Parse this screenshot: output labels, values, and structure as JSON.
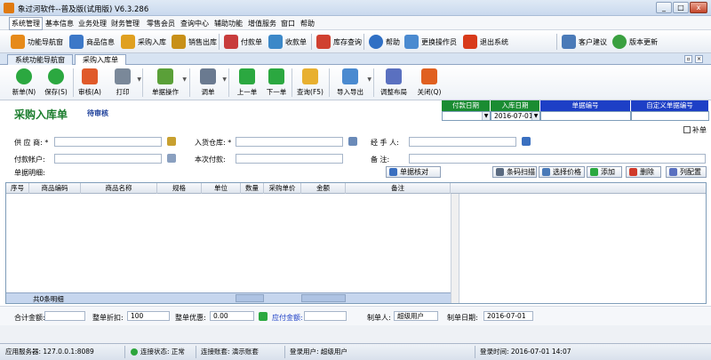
{
  "window": {
    "title": "象过河软件--普及版(试用版) V6.3.286",
    "min": "_",
    "max": "□",
    "close": "x"
  },
  "menu": [
    "系统管理",
    "基本信息",
    "业务处理",
    "财务管理",
    "零售会员",
    "查询中心",
    "辅助功能",
    "增值服务",
    "窗口",
    "帮助"
  ],
  "quickbar": [
    {
      "label": "功能导航窗",
      "icon": "home-icon",
      "color": "#e68a1a"
    },
    {
      "label": "商品信息",
      "icon": "product-grid-icon",
      "color": "#3c78c8"
    },
    {
      "label": "采购入库",
      "icon": "purchase-in-icon",
      "color": "#e0a020"
    },
    {
      "label": "销售出库",
      "icon": "sales-out-icon",
      "color": "#c89018"
    },
    {
      "label": "付款单",
      "icon": "payment-icon",
      "color": "#c83c3c"
    },
    {
      "label": "收款单",
      "icon": "receipt-icon",
      "color": "#3c88c8"
    },
    {
      "label": "库存查询",
      "icon": "stock-query-icon",
      "color": "#d04030"
    },
    {
      "label": "帮助",
      "icon": "help-icon",
      "color": "#2f6fc4"
    },
    {
      "label": "更换操作员",
      "icon": "change-operator-icon",
      "color": "#4a8ad0"
    },
    {
      "label": "退出系统",
      "icon": "exit-icon",
      "color": "#d83a1a"
    },
    {
      "label": "客户建议",
      "icon": "suggestion-icon",
      "color": "#4a7ab8"
    },
    {
      "label": "版本更新",
      "icon": "update-icon",
      "color": "#3aa040"
    }
  ],
  "tabs": [
    "系统功能导航窗",
    "采购入库单"
  ],
  "toolbar": [
    {
      "label": "新单(N)",
      "icon": "new-plus-icon",
      "color": "#2ba840"
    },
    {
      "label": "保存(S)",
      "icon": "save-check-icon",
      "color": "#2ba840"
    },
    {
      "label": "审核(A)",
      "icon": "audit-icon",
      "color": "#e05a2a"
    },
    {
      "label": "打印",
      "icon": "print-icon",
      "color": "#7a8899"
    },
    {
      "label": "单据操作",
      "icon": "document-icon",
      "color": "#5aa038"
    },
    {
      "label": "调单",
      "icon": "call-bill-icon",
      "color": "#6a7a90"
    },
    {
      "label": "上一单",
      "icon": "prev-icon",
      "color": "#2ba840"
    },
    {
      "label": "下一单",
      "icon": "next-icon",
      "color": "#2ba840"
    },
    {
      "label": "查询(F5)",
      "icon": "query-icon",
      "color": "#e8b030"
    },
    {
      "label": "导入导出",
      "icon": "import-export-icon",
      "color": "#4a8ad0"
    },
    {
      "label": "调整布局",
      "icon": "layout-icon",
      "color": "#5a70c0"
    },
    {
      "label": "关闭(Q)",
      "icon": "close-x-icon",
      "color": "#e06020"
    }
  ],
  "form": {
    "title": "采购入库单",
    "status": "待审核",
    "header_cols": [
      {
        "label": "付款日期",
        "value": ""
      },
      {
        "label": "入库日期",
        "value": "2016-07-01"
      },
      {
        "label": "单据编号",
        "value": ""
      },
      {
        "label": "自定义单据编号",
        "value": ""
      }
    ],
    "supplement": "补单",
    "fields": {
      "supplier": "供 应 商: *",
      "warehouse": "入货仓库: *",
      "handler": "经 手 人:",
      "pay_account": "付款帐户:",
      "this_payment": "本次付款:",
      "note": "备    注:"
    },
    "detail_label": "单据明细:",
    "actions": {
      "check": "单据核对",
      "scan": "条码扫描",
      "price": "选择价格",
      "add": "添加",
      "delete": "删除",
      "columns": "列配置"
    },
    "columns": [
      "序号",
      "商品编码",
      "商品名称",
      "规格",
      "单位",
      "数量",
      "采购单价",
      "金额",
      "备注"
    ],
    "row_count": "共0条明细"
  },
  "summary": {
    "total_label": "合计金额:",
    "total_value": "",
    "discount_label": "整单折扣:",
    "discount_value": "100",
    "preferential_label": "整单优惠:",
    "preferential_value": "0.00",
    "payable_label": "应付金额:",
    "payable_value": "",
    "maker_label": "制单人:",
    "maker_value": "超级用户",
    "date_label": "制单日期:",
    "date_value": "2016-07-01"
  },
  "status": {
    "server": "应用服务器: 127.0.0.1:8089",
    "connect": "连接状态: 正常",
    "account": "连接账套: 演示账套",
    "user": "登录用户: 超级用户",
    "login_time": "登录时间: 2016-07-01 14:07"
  }
}
